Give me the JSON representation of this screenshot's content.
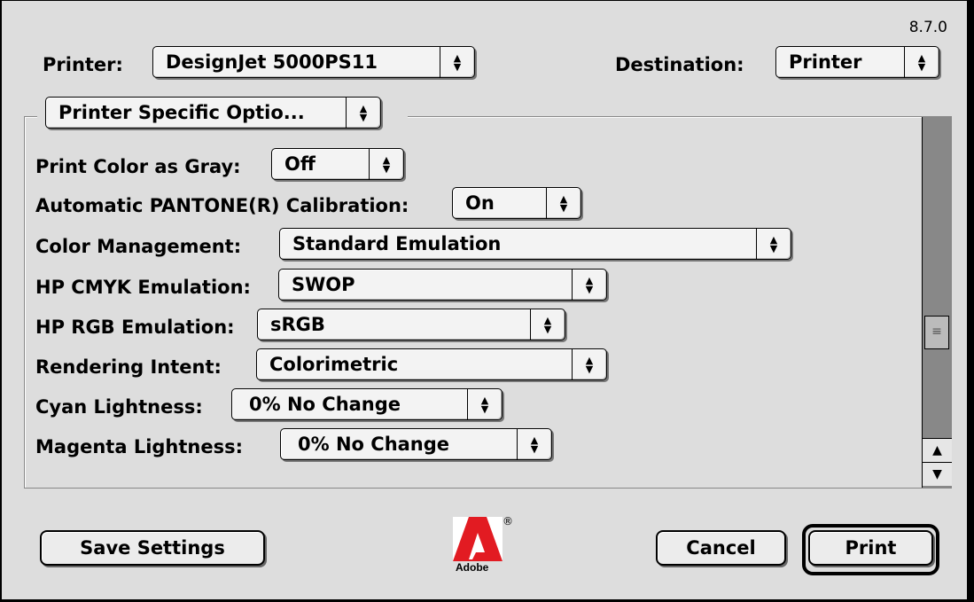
{
  "version": "8.7.0",
  "printer": {
    "label": "Printer:",
    "value": "DesignJet 5000PS11"
  },
  "destination": {
    "label": "Destination:",
    "value": "Printer"
  },
  "section_popup": {
    "value": "Printer Specific Optio..."
  },
  "options": [
    {
      "label": "Print Color as Gray:",
      "value": "Off"
    },
    {
      "label": "Automatic PANTONE(R) Calibration:",
      "value": "On"
    },
    {
      "label": "Color Management:",
      "value": "Standard Emulation"
    },
    {
      "label": "HP CMYK Emulation:",
      "value": "SWOP"
    },
    {
      "label": "HP RGB Emulation:",
      "value": "sRGB"
    },
    {
      "label": "Rendering Intent:",
      "value": "Colorimetric"
    },
    {
      "label": "Cyan Lightness:",
      "value": "0% No Change"
    },
    {
      "label": "Magenta Lightness:",
      "value": "0% No Change"
    }
  ],
  "buttons": {
    "save": "Save Settings",
    "cancel": "Cancel",
    "print": "Print"
  },
  "logo": {
    "name": "adobe-logo",
    "text": "Adobe",
    "reg": "®"
  },
  "icons": {
    "popup_arrows": "up-down-arrows-icon",
    "scroll_up": "up-arrow-icon",
    "scroll_down": "down-arrow-icon",
    "thumb": "grip-icon"
  },
  "colors": {
    "dialog": "#dddddd",
    "scroll_track": "#888888",
    "logo_red": "#e21b22"
  }
}
